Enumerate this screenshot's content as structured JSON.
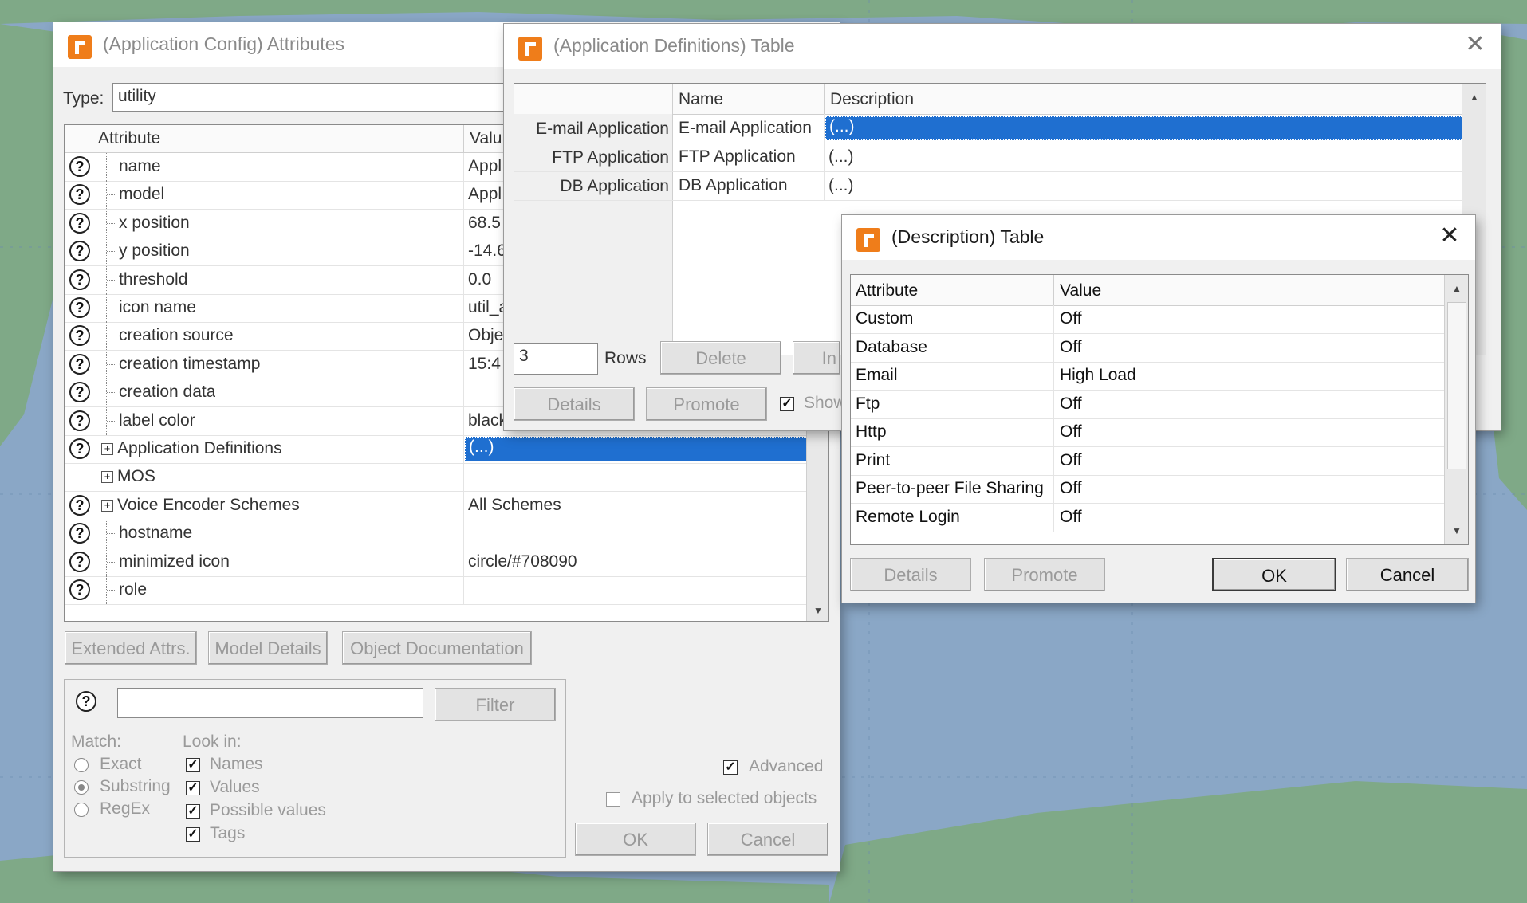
{
  "colors": {
    "accent": "#1f6fd0",
    "ocean": "#8aa7c6",
    "land": "#7fa987",
    "app_icon": "#ef7d1a"
  },
  "attrs_window": {
    "title": "(Application Config) Attributes",
    "type_label": "Type:",
    "type_value": "utility",
    "columns": [
      "Attribute",
      "Valu"
    ],
    "rows": [
      {
        "name": "name",
        "value": "Appl",
        "help": true,
        "expander": false
      },
      {
        "name": "model",
        "value": "Appl",
        "help": true,
        "expander": false
      },
      {
        "name": "x position",
        "value": "68.5",
        "help": true,
        "expander": false
      },
      {
        "name": "y position",
        "value": "-14.6",
        "help": true,
        "expander": false
      },
      {
        "name": "threshold",
        "value": "0.0",
        "help": true,
        "expander": false
      },
      {
        "name": "icon name",
        "value": "util_a",
        "help": true,
        "expander": false
      },
      {
        "name": "creation source",
        "value": "Obje",
        "help": true,
        "expander": false
      },
      {
        "name": "creation timestamp",
        "value": "15:4",
        "help": true,
        "expander": false
      },
      {
        "name": "creation data",
        "value": "",
        "help": true,
        "expander": false
      },
      {
        "name": "label color",
        "value": "black",
        "help": true,
        "expander": false
      },
      {
        "name": "Application Definitions",
        "value": "(...)",
        "help": true,
        "expander": true
      },
      {
        "name": "MOS",
        "value": "",
        "help": false,
        "expander": true
      },
      {
        "name": "Voice Encoder Schemes",
        "value": "All Schemes",
        "help": true,
        "expander": true
      },
      {
        "name": "hostname",
        "value": "",
        "help": true,
        "expander": false
      },
      {
        "name": "minimized icon",
        "value": "circle/#708090",
        "help": true,
        "expander": false
      },
      {
        "name": "role",
        "value": "",
        "help": true,
        "expander": false
      }
    ],
    "buttons": {
      "extended": "Extended Attrs.",
      "model_details": "Model Details",
      "object_doc": "Object Documentation",
      "filter": "Filter",
      "ok": "OK",
      "cancel": "Cancel"
    },
    "filter_value": "",
    "match_label": "Match:",
    "match_options": [
      "Exact",
      "Substring",
      "RegEx"
    ],
    "look_in_label": "Look in:",
    "look_in_options": [
      "Names",
      "Values",
      "Possible values",
      "Tags"
    ],
    "advanced_label": "Advanced",
    "apply_label": "Apply to selected objects"
  },
  "appdef_window": {
    "title": "(Application Definitions) Table",
    "columns": [
      "Name",
      "Description"
    ],
    "rows": [
      {
        "row_header": "E-mail  Application",
        "name": "E-mail  Application",
        "description": "(...)"
      },
      {
        "row_header": "FTP Application",
        "name": "FTP Application",
        "description": "(...)"
      },
      {
        "row_header": "DB Application",
        "name": "DB Application",
        "description": "(...)"
      }
    ],
    "rows_value": "3",
    "rows_label": "Rows",
    "buttons": {
      "delete": "Delete",
      "insert": "In",
      "details": "Details",
      "promote": "Promote",
      "show": "Show"
    }
  },
  "desc_window": {
    "title": "(Description) Table",
    "columns": [
      "Attribute",
      "Value"
    ],
    "rows": [
      {
        "attribute": "Custom",
        "value": "Off"
      },
      {
        "attribute": "Database",
        "value": "Off"
      },
      {
        "attribute": "Email",
        "value": "High Load"
      },
      {
        "attribute": "Ftp",
        "value": "Off"
      },
      {
        "attribute": "Http",
        "value": "Off"
      },
      {
        "attribute": "Print",
        "value": "Off"
      },
      {
        "attribute": "Peer-to-peer File Sharing",
        "value": "Off"
      },
      {
        "attribute": "Remote Login",
        "value": "Off"
      }
    ],
    "buttons": {
      "details": "Details",
      "promote": "Promote",
      "ok": "OK",
      "cancel": "Cancel"
    }
  }
}
